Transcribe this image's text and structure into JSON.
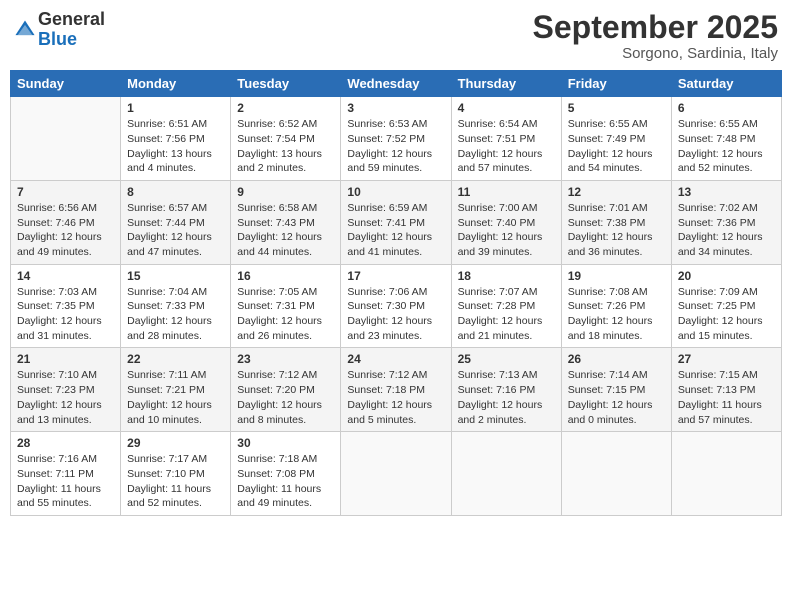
{
  "header": {
    "logo_general": "General",
    "logo_blue": "Blue",
    "month_title": "September 2025",
    "location": "Sorgono, Sardinia, Italy"
  },
  "days_of_week": [
    "Sunday",
    "Monday",
    "Tuesday",
    "Wednesday",
    "Thursday",
    "Friday",
    "Saturday"
  ],
  "weeks": [
    [
      {
        "day": "",
        "info": ""
      },
      {
        "day": "1",
        "info": "Sunrise: 6:51 AM\nSunset: 7:56 PM\nDaylight: 13 hours\nand 4 minutes."
      },
      {
        "day": "2",
        "info": "Sunrise: 6:52 AM\nSunset: 7:54 PM\nDaylight: 13 hours\nand 2 minutes."
      },
      {
        "day": "3",
        "info": "Sunrise: 6:53 AM\nSunset: 7:52 PM\nDaylight: 12 hours\nand 59 minutes."
      },
      {
        "day": "4",
        "info": "Sunrise: 6:54 AM\nSunset: 7:51 PM\nDaylight: 12 hours\nand 57 minutes."
      },
      {
        "day": "5",
        "info": "Sunrise: 6:55 AM\nSunset: 7:49 PM\nDaylight: 12 hours\nand 54 minutes."
      },
      {
        "day": "6",
        "info": "Sunrise: 6:55 AM\nSunset: 7:48 PM\nDaylight: 12 hours\nand 52 minutes."
      }
    ],
    [
      {
        "day": "7",
        "info": "Sunrise: 6:56 AM\nSunset: 7:46 PM\nDaylight: 12 hours\nand 49 minutes."
      },
      {
        "day": "8",
        "info": "Sunrise: 6:57 AM\nSunset: 7:44 PM\nDaylight: 12 hours\nand 47 minutes."
      },
      {
        "day": "9",
        "info": "Sunrise: 6:58 AM\nSunset: 7:43 PM\nDaylight: 12 hours\nand 44 minutes."
      },
      {
        "day": "10",
        "info": "Sunrise: 6:59 AM\nSunset: 7:41 PM\nDaylight: 12 hours\nand 41 minutes."
      },
      {
        "day": "11",
        "info": "Sunrise: 7:00 AM\nSunset: 7:40 PM\nDaylight: 12 hours\nand 39 minutes."
      },
      {
        "day": "12",
        "info": "Sunrise: 7:01 AM\nSunset: 7:38 PM\nDaylight: 12 hours\nand 36 minutes."
      },
      {
        "day": "13",
        "info": "Sunrise: 7:02 AM\nSunset: 7:36 PM\nDaylight: 12 hours\nand 34 minutes."
      }
    ],
    [
      {
        "day": "14",
        "info": "Sunrise: 7:03 AM\nSunset: 7:35 PM\nDaylight: 12 hours\nand 31 minutes."
      },
      {
        "day": "15",
        "info": "Sunrise: 7:04 AM\nSunset: 7:33 PM\nDaylight: 12 hours\nand 28 minutes."
      },
      {
        "day": "16",
        "info": "Sunrise: 7:05 AM\nSunset: 7:31 PM\nDaylight: 12 hours\nand 26 minutes."
      },
      {
        "day": "17",
        "info": "Sunrise: 7:06 AM\nSunset: 7:30 PM\nDaylight: 12 hours\nand 23 minutes."
      },
      {
        "day": "18",
        "info": "Sunrise: 7:07 AM\nSunset: 7:28 PM\nDaylight: 12 hours\nand 21 minutes."
      },
      {
        "day": "19",
        "info": "Sunrise: 7:08 AM\nSunset: 7:26 PM\nDaylight: 12 hours\nand 18 minutes."
      },
      {
        "day": "20",
        "info": "Sunrise: 7:09 AM\nSunset: 7:25 PM\nDaylight: 12 hours\nand 15 minutes."
      }
    ],
    [
      {
        "day": "21",
        "info": "Sunrise: 7:10 AM\nSunset: 7:23 PM\nDaylight: 12 hours\nand 13 minutes."
      },
      {
        "day": "22",
        "info": "Sunrise: 7:11 AM\nSunset: 7:21 PM\nDaylight: 12 hours\nand 10 minutes."
      },
      {
        "day": "23",
        "info": "Sunrise: 7:12 AM\nSunset: 7:20 PM\nDaylight: 12 hours\nand 8 minutes."
      },
      {
        "day": "24",
        "info": "Sunrise: 7:12 AM\nSunset: 7:18 PM\nDaylight: 12 hours\nand 5 minutes."
      },
      {
        "day": "25",
        "info": "Sunrise: 7:13 AM\nSunset: 7:16 PM\nDaylight: 12 hours\nand 2 minutes."
      },
      {
        "day": "26",
        "info": "Sunrise: 7:14 AM\nSunset: 7:15 PM\nDaylight: 12 hours\nand 0 minutes."
      },
      {
        "day": "27",
        "info": "Sunrise: 7:15 AM\nSunset: 7:13 PM\nDaylight: 11 hours\nand 57 minutes."
      }
    ],
    [
      {
        "day": "28",
        "info": "Sunrise: 7:16 AM\nSunset: 7:11 PM\nDaylight: 11 hours\nand 55 minutes."
      },
      {
        "day": "29",
        "info": "Sunrise: 7:17 AM\nSunset: 7:10 PM\nDaylight: 11 hours\nand 52 minutes."
      },
      {
        "day": "30",
        "info": "Sunrise: 7:18 AM\nSunset: 7:08 PM\nDaylight: 11 hours\nand 49 minutes."
      },
      {
        "day": "",
        "info": ""
      },
      {
        "day": "",
        "info": ""
      },
      {
        "day": "",
        "info": ""
      },
      {
        "day": "",
        "info": ""
      }
    ]
  ]
}
